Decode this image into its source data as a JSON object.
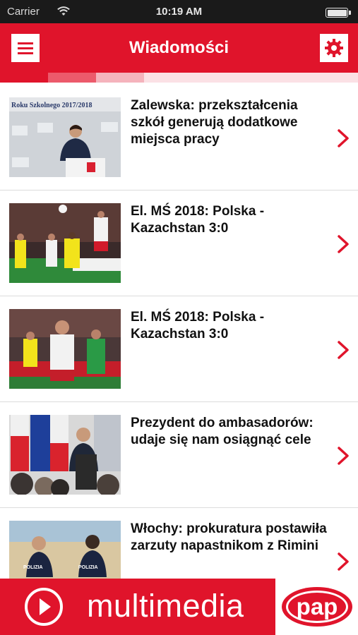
{
  "status_bar": {
    "carrier": "Carrier",
    "time": "10:19 AM"
  },
  "nav": {
    "title": "Wiadomości"
  },
  "colors": {
    "brand_red": "#e0142b",
    "strip": [
      "#e0142b",
      "#ec5a6b",
      "#f5b3bc",
      "#fbe1e5"
    ]
  },
  "articles": [
    {
      "headline": "Zalewska: przekształcenia szkół generują dodatkowe miejsca pracy",
      "thumb_text": "Roku Szkolnego 2017/2018"
    },
    {
      "headline": "El. MŚ 2018: Polska - Kazachstan 3:0"
    },
    {
      "headline": "El. MŚ 2018: Polska - Kazachstan 3:0"
    },
    {
      "headline": "Prezydent do ambasadorów: udaje się nam osiągnąć cele"
    },
    {
      "headline": "Włochy: prokuratura postawiła zarzuty napastnikom z Rimini",
      "thumb_text": "POLIZIA"
    }
  ],
  "banner": {
    "label": "multimedia",
    "logo_text": "pap"
  }
}
